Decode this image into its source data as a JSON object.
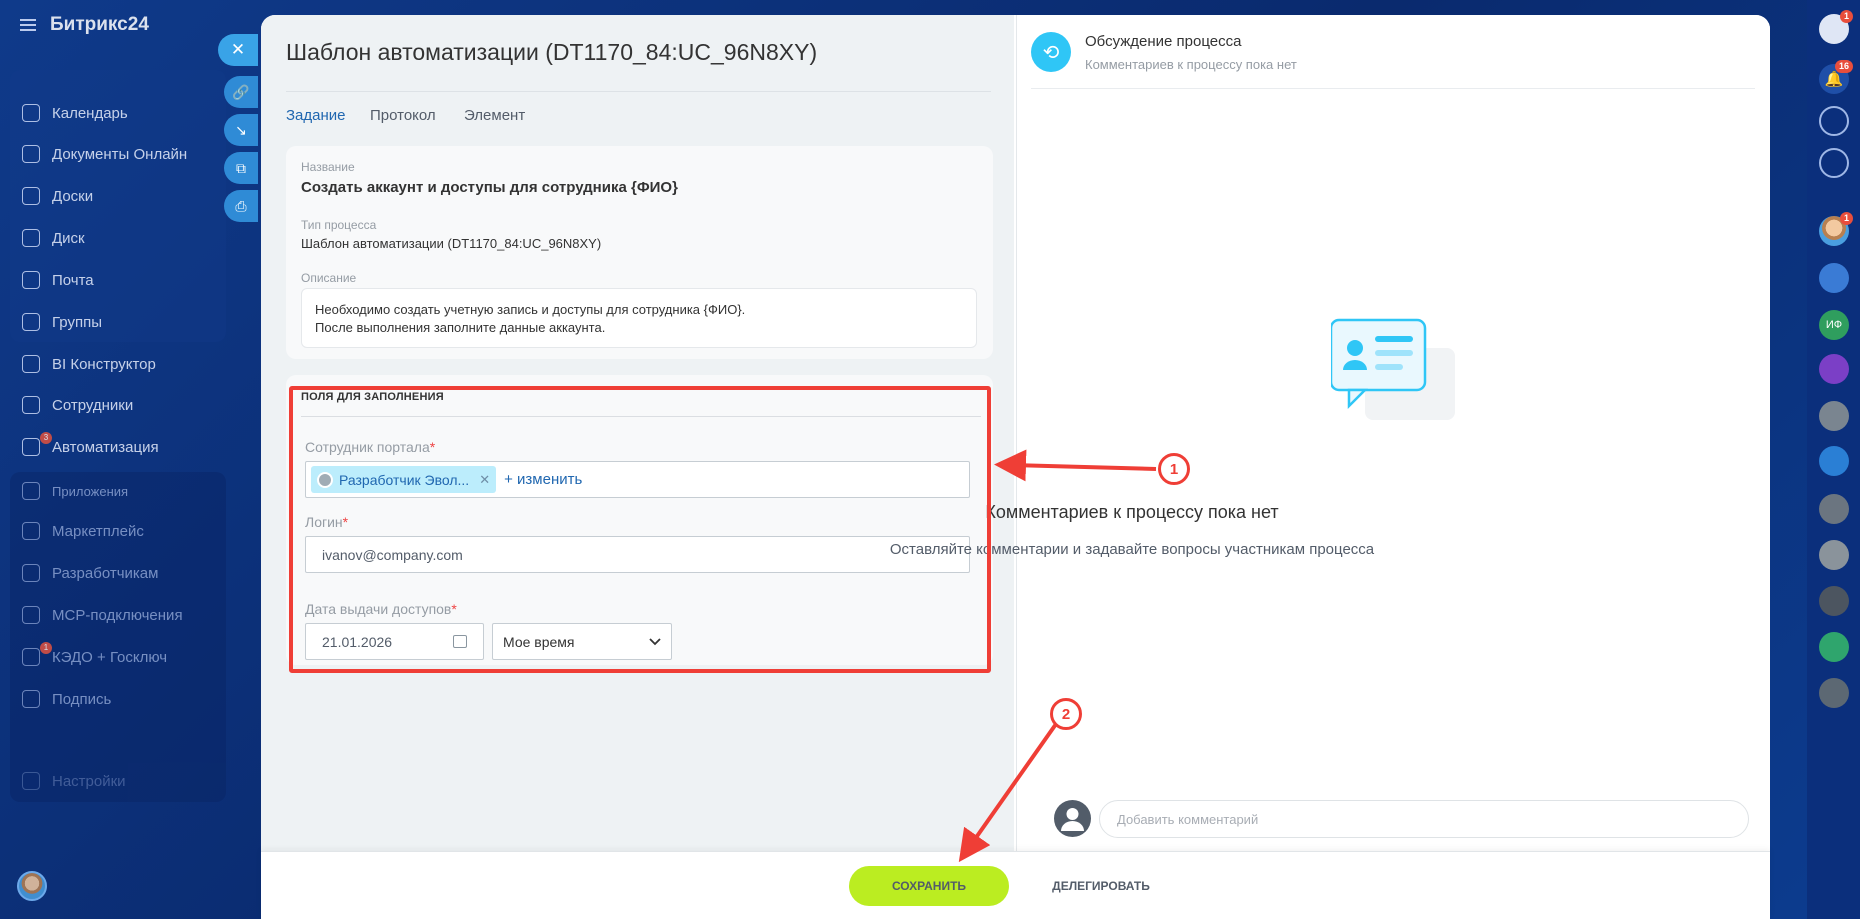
{
  "app": {
    "brand": "Битрикс24"
  },
  "leftnav": {
    "items": [
      {
        "label": "Календарь"
      },
      {
        "label": "Документы Онлайн"
      },
      {
        "label": "Доски"
      },
      {
        "label": "Диск"
      },
      {
        "label": "Почта"
      },
      {
        "label": "Группы"
      },
      {
        "label": "BI Конструктор"
      },
      {
        "label": "Сотрудники"
      },
      {
        "label": "Автоматизация",
        "badge": "3"
      },
      {
        "label": "Приложения"
      },
      {
        "label": "Маркетплейс"
      },
      {
        "label": "Разработчикам"
      },
      {
        "label": "MCP-подключения"
      },
      {
        "label": "КЭДО + Госключ",
        "badge": "1"
      },
      {
        "label": "Подпись"
      },
      {
        "label": "Настройки"
      }
    ]
  },
  "rail": {
    "badges": [
      "1",
      "16",
      "1"
    ],
    "initials": "ИФ"
  },
  "panel": {
    "title": "Шаблон автоматизации (DT1170_84:UC_96N8XY)",
    "tabs": [
      "Задание",
      "Протокол",
      "Элемент"
    ],
    "name_label": "Название",
    "name_value": "Создать аккаунт и доступы для сотрудника {ФИО}",
    "type_label": "Тип процесса",
    "type_value": "Шаблон автоматизации (DT1170_84:UC_96N8XY)",
    "desc_label": "Описание",
    "desc_line1": "Необходимо создать учетную запись и доступы для сотрудника {ФИО}.",
    "desc_line2": "После выполнения заполните данные аккаунта.",
    "fields_title": "ПОЛЯ ДЛЯ ЗАПОЛНЕНИЯ",
    "employee_label": "Сотрудник портала",
    "employee_chip": "Разработчик Эвол...",
    "employee_change": "+ изменить",
    "login_label": "Логин",
    "login_value": "ivanov@company.com",
    "date_label": "Дата выдачи доступов",
    "date_value": "21.01.2026",
    "time_value": "Мое время",
    "required_mark": "*"
  },
  "discussion": {
    "title": "Обсуждение процесса",
    "subtitle": "Комментариев к процессу пока нет",
    "empty_title": "Комментариев к процессу пока нет",
    "empty_sub": "Оставляйте комментарии и задавайте вопросы участникам процесса",
    "comment_placeholder": "Добавить комментарий"
  },
  "footer": {
    "save": "СОХРАНИТЬ",
    "delegate": "ДЕЛЕГИРОВАТЬ"
  },
  "callouts": [
    "1",
    "2"
  ],
  "colors": {
    "accent": "#2067b0",
    "save": "#bbed21",
    "annotation": "#ef3e36"
  }
}
